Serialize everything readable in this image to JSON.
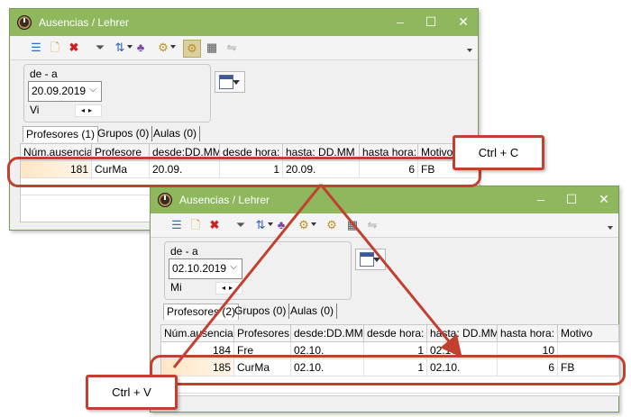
{
  "window1": {
    "title": "Ausencias / Lehrer",
    "range_label": "de - a",
    "date": "20.09.2019",
    "weekday": "Vi",
    "tabs": [
      "Profesores (1)",
      "Grupos (0)",
      "Aulas (0)"
    ],
    "columns": [
      "Núm.ausencia",
      "Profesore",
      "desde:DD.MM",
      "desde hora:",
      "hasta: DD.MM",
      "hasta hora:",
      "Motivo"
    ],
    "rows": [
      {
        "num": "181",
        "prof": "CurMa",
        "desde": "20.09.",
        "desde_hora": "1",
        "hasta": "20.09.",
        "hasta_hora": "6",
        "motivo": "FB"
      }
    ]
  },
  "window2": {
    "title": "Ausencias / Lehrer",
    "range_label": "de - a",
    "date": "02.10.2019",
    "weekday": "Mi",
    "tabs": [
      "Profesores (2)",
      "Grupos (0)",
      "Aulas (0)"
    ],
    "columns": [
      "Núm.ausencia",
      "Profesores",
      "desde:DD.MM",
      "desde hora:",
      "hasta: DD.MM",
      "hasta hora:",
      "Motivo"
    ],
    "rows": [
      {
        "num": "184",
        "prof": "Fre",
        "desde": "02.10.",
        "desde_hora": "1",
        "hasta": "02.10.",
        "hasta_hora": "10",
        "motivo": ""
      },
      {
        "num": "185",
        "prof": "CurMa",
        "desde": "02.10.",
        "desde_hora": "1",
        "hasta": "02.10.",
        "hasta_hora": "6",
        "motivo": "FB"
      }
    ]
  },
  "callouts": {
    "copy": "Ctrl + C",
    "paste": "Ctrl + V"
  },
  "colors": {
    "titlebar": "#8fb85e",
    "highlight": "#c14030",
    "selection": "#ffe6c4"
  },
  "toolbar_icons": [
    "list-icon",
    "new-icon",
    "delete-icon",
    "filter-icon",
    "sort-icon",
    "people-icon",
    "settings-icon",
    "gear-icon",
    "calendar-table-icon",
    "link-icon"
  ]
}
